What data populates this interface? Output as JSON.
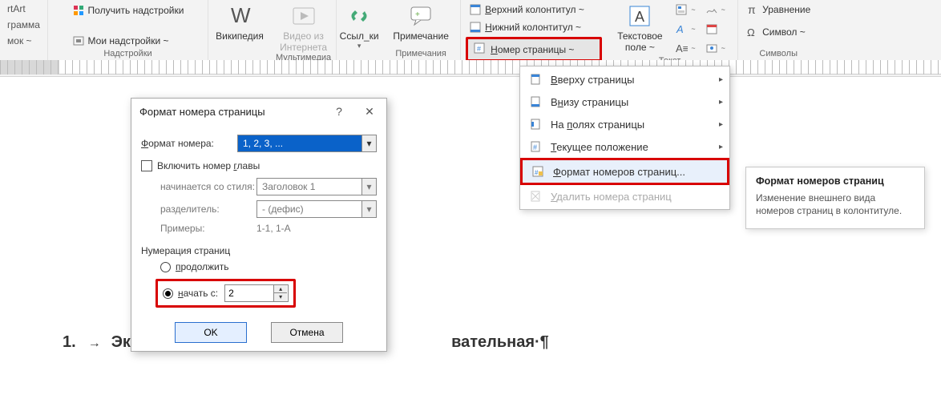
{
  "ribbon": {
    "smartart_line1": "rtArt",
    "smartart_line2": "грамма",
    "smartart_line3": "мок ~",
    "get_addins": "Получить надстройки",
    "my_addins": "Мои надстройки ~",
    "addins_group": "Надстройки",
    "wikipedia": "Википедия",
    "video": "Видео из Интернета",
    "multimedia_group": "Мультимедиа",
    "links": "Ссыл_ки",
    "comment": "Примечание",
    "comments_group": "Примечания",
    "header": "Верхний колонтитул ~",
    "footer": "Нижний колонтитул ~",
    "page_number": "Номер страницы ~",
    "textbox_line1": "Текстовое",
    "textbox_line2": "поле ~",
    "text_group": "Текст",
    "equation": "Уравнение",
    "symbol": "Символ ~",
    "symbols_group": "Символы"
  },
  "dialog": {
    "title": "Формат номера страницы",
    "format_label": "Формат номера:",
    "format_value": "1, 2, 3, ...",
    "include_chapter": "Включить номер главы",
    "starts_with_style": "начинается со стиля:",
    "style_value": "Заголовок 1",
    "separator_label": "разделитель:",
    "separator_value": "-   (дефис)",
    "examples_label": "Примеры:",
    "examples_value": "1-1, 1-A",
    "numbering_label": "Нумерация страниц",
    "continue": "продолжить",
    "start_at": "начать с:",
    "start_value": "2",
    "ok": "OK",
    "cancel": "Отмена"
  },
  "menu": {
    "top": "Вверху страницы",
    "bottom": "Внизу страницы",
    "margins": "На полях страницы",
    "current": "Текущее положение",
    "format": "Формат номеров страниц...",
    "remove": "Удалить номера страниц"
  },
  "tooltip": {
    "title": "Формат номеров страниц",
    "body": "Изменение внешнего вида номеров страниц в колонтитуле."
  },
  "doc": {
    "num": "1.",
    "arrow": "→",
    "text_left": "Эко",
    "text_right": "вательная·¶"
  }
}
